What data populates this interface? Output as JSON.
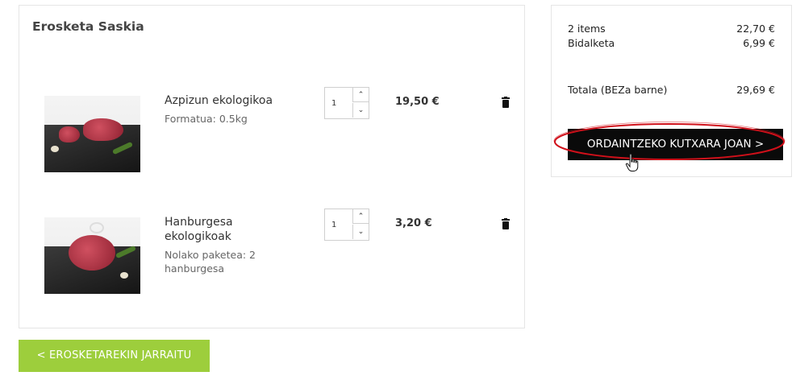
{
  "cart": {
    "title": "Erosketa Saskia",
    "items": [
      {
        "name": "Azpizun ekologikoa",
        "meta": "Formatua: 0.5kg",
        "quantity": "1",
        "price": "19,50 €",
        "image_icon": "meat-cut-icon"
      },
      {
        "name": "Hanburgesa ekologikoak",
        "meta": "Nolako paketea: 2 hanburgesa",
        "quantity": "1",
        "price": "3,20 €",
        "image_icon": "burger-patty-icon"
      }
    ],
    "continue_label": "< EROSKETAREKIN JARRAITU"
  },
  "summary": {
    "items_label": "2 items",
    "items_value": "22,70 €",
    "shipping_label": "Bidalketa",
    "shipping_value": "6,99 €",
    "total_label": "Totala (BEZa barne)",
    "total_value": "29,69 €",
    "checkout_label": "ORDAINTZEKO KUTXARA JOAN >"
  },
  "colors": {
    "accent_green": "#9dce3c",
    "checkout_black": "#0a0a0a",
    "highlight_red": "#d0101a"
  }
}
